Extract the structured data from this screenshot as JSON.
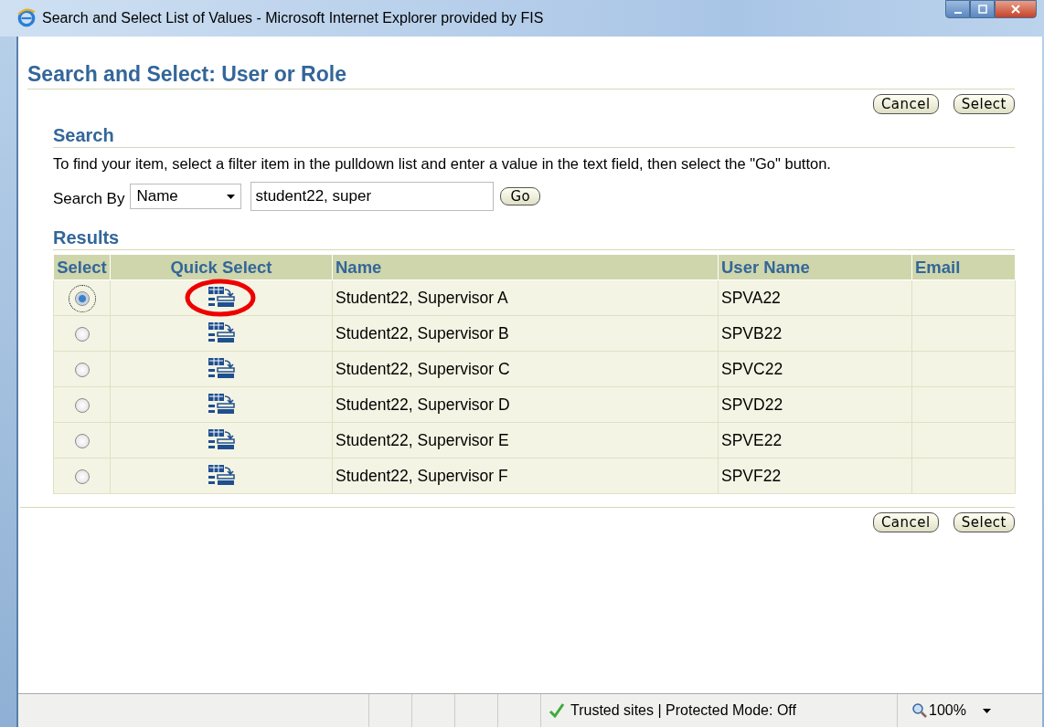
{
  "window": {
    "title": "Search and Select List of Values - Microsoft Internet Explorer provided by FIS"
  },
  "page_title": "Search and Select: User or Role",
  "top_buttons": [
    "Cancel",
    "Select"
  ],
  "search": {
    "heading": "Search",
    "instructions": "To find your item, select a filter item in the pulldown list and enter a value in the text field, then select the \"Go\" button.",
    "label": "Search By",
    "filter": "Name",
    "value": "student22, super",
    "go": "Go"
  },
  "results": {
    "heading": "Results",
    "columns": [
      "Select",
      "Quick Select",
      "Name",
      "User Name",
      "Email"
    ],
    "rows": [
      {
        "selected": true,
        "name": "Student22, Supervisor A",
        "user_name": "SPVA22",
        "highlighted": true
      },
      {
        "selected": false,
        "name": "Student22, Supervisor B",
        "user_name": "SPVB22",
        "highlighted": false
      },
      {
        "selected": false,
        "name": "Student22, Supervisor C",
        "user_name": "SPVC22",
        "highlighted": false
      },
      {
        "selected": false,
        "name": "Student22, Supervisor D",
        "user_name": "SPVD22",
        "highlighted": false
      },
      {
        "selected": false,
        "name": "Student22, Supervisor E",
        "user_name": "SPVE22",
        "highlighted": false
      },
      {
        "selected": false,
        "name": "Student22, Supervisor F",
        "user_name": "SPVF22",
        "highlighted": false
      }
    ]
  },
  "bottom_buttons": [
    "Cancel",
    "Select"
  ],
  "status_bar": {
    "zone": "Trusted sites | Protected Mode: Off",
    "zoom": "100%"
  }
}
